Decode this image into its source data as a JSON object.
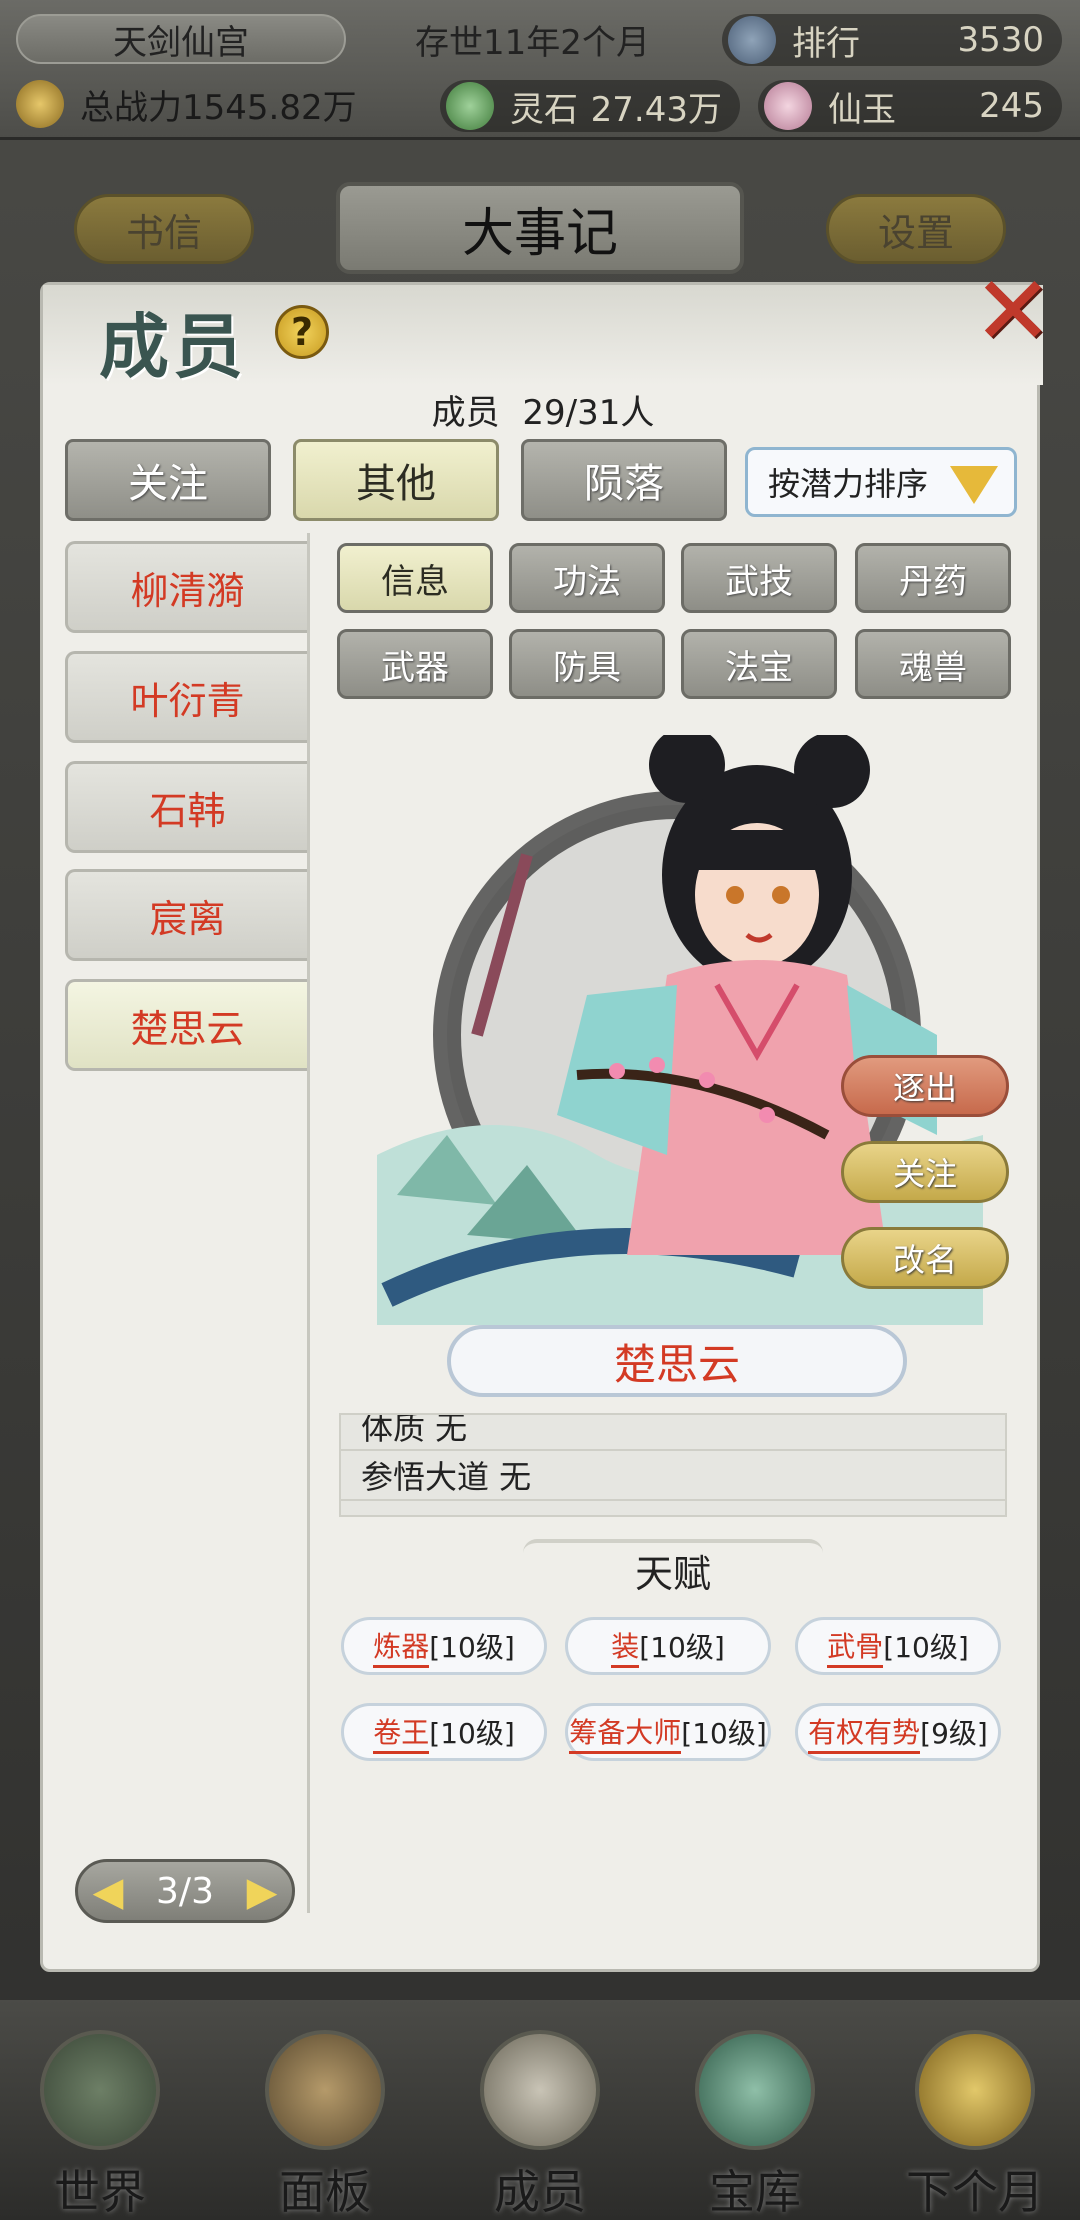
{
  "topbar": {
    "sect_name": "天剑仙宫",
    "time": "存世11年2个月",
    "rank_label": "排行",
    "rank_value": "3530",
    "power": "总战力1545.82万",
    "spirit_stone_label": "灵石",
    "spirit_stone_value": "27.43万",
    "jade_label": "仙玉",
    "jade_value": "245"
  },
  "background": {
    "left_button": "书信",
    "banner": "大事记",
    "right_button": "设置"
  },
  "panel": {
    "title": "成员",
    "help_icon": "?",
    "close_icon": "✕",
    "member_count_label": "成员",
    "member_count_value": "29/31人",
    "tabs": [
      {
        "label": "关注",
        "active": false
      },
      {
        "label": "其他",
        "active": true
      },
      {
        "label": "陨落",
        "active": false
      }
    ],
    "sort_label": "按潜力排序",
    "members": [
      {
        "name": "柳清漪",
        "active": false
      },
      {
        "name": "叶衍青",
        "active": false
      },
      {
        "name": "石韩",
        "active": false
      },
      {
        "name": "宸离",
        "active": false
      },
      {
        "name": "楚思云",
        "active": true
      }
    ],
    "pager": "3/3",
    "sub_tabs": [
      {
        "label": "信息",
        "active": true
      },
      {
        "label": "功法",
        "active": false
      },
      {
        "label": "武技",
        "active": false
      },
      {
        "label": "丹药",
        "active": false
      },
      {
        "label": "武器",
        "active": false
      },
      {
        "label": "防具",
        "active": false
      },
      {
        "label": "法宝",
        "active": false
      },
      {
        "label": "魂兽",
        "active": false
      }
    ],
    "actions": {
      "expel": "逐出",
      "follow": "关注",
      "rename": "改名"
    },
    "selected_name": "楚思云",
    "info_rows": [
      "体质 无",
      "参悟大道 无"
    ],
    "talent_header": "天赋",
    "talents": [
      {
        "name": "炼器",
        "level": "[10级]"
      },
      {
        "name": "装",
        "level": "[10级]"
      },
      {
        "name": "武骨",
        "level": "[10级]"
      },
      {
        "name": "卷王",
        "level": "[10级]"
      },
      {
        "name": "筹备大师",
        "level": "[10级]"
      },
      {
        "name": "有权有势",
        "level": "[9级]"
      }
    ]
  },
  "bottom_nav": {
    "items": [
      "世界",
      "面板",
      "成员",
      "宝库",
      "下个月"
    ]
  },
  "colors": {
    "accent_red": "#d33a24",
    "active_tab": "#f1f0cf",
    "inactive_tab": "#8f8f88"
  }
}
